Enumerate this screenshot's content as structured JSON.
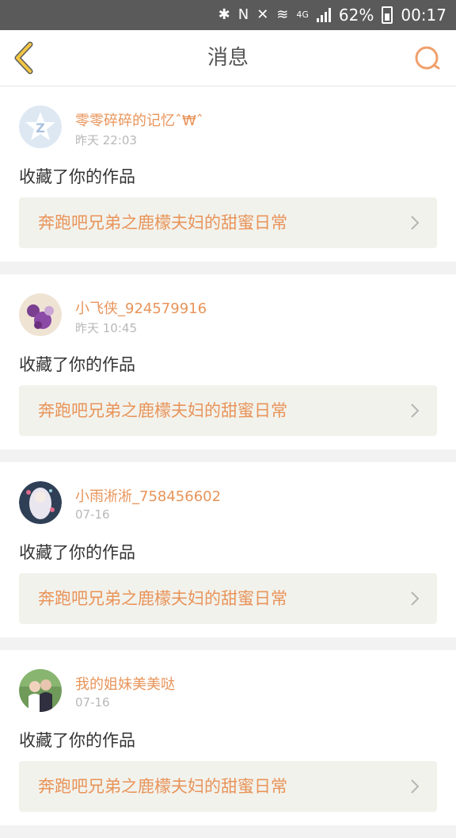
{
  "status_bar": {
    "battery": "62%",
    "time": "00:17",
    "network": "4G"
  },
  "header": {
    "title": "消息",
    "back_icon": "chevron-left-icon",
    "search_icon": "search-icon",
    "accent_color": "#f0a06c"
  },
  "messages": [
    {
      "user": "零零碎碎的记忆ˆ₩ˆ",
      "time": "昨天 22:03",
      "action": "收藏了你的作品",
      "work": "奔跑吧兄弟之鹿檬夫妇的甜蜜日常",
      "avatar": "qq-default-avatar"
    },
    {
      "user": "小飞侠_924579916",
      "time": "昨天 10:45",
      "action": "收藏了你的作品",
      "work": "奔跑吧兄弟之鹿檬夫妇的甜蜜日常",
      "avatar": "purple-flower-avatar"
    },
    {
      "user": "小雨淅淅_758456602",
      "time": "07-16",
      "action": "收藏了你的作品",
      "work": "奔跑吧兄弟之鹿檬夫妇的甜蜜日常",
      "avatar": "anime-girl-avatar"
    },
    {
      "user": "我的姐妹美美哒",
      "time": "07-16",
      "action": "收藏了你的作品",
      "work": "奔跑吧兄弟之鹿檬夫妇的甜蜜日常",
      "avatar": "couple-photo-avatar"
    }
  ]
}
